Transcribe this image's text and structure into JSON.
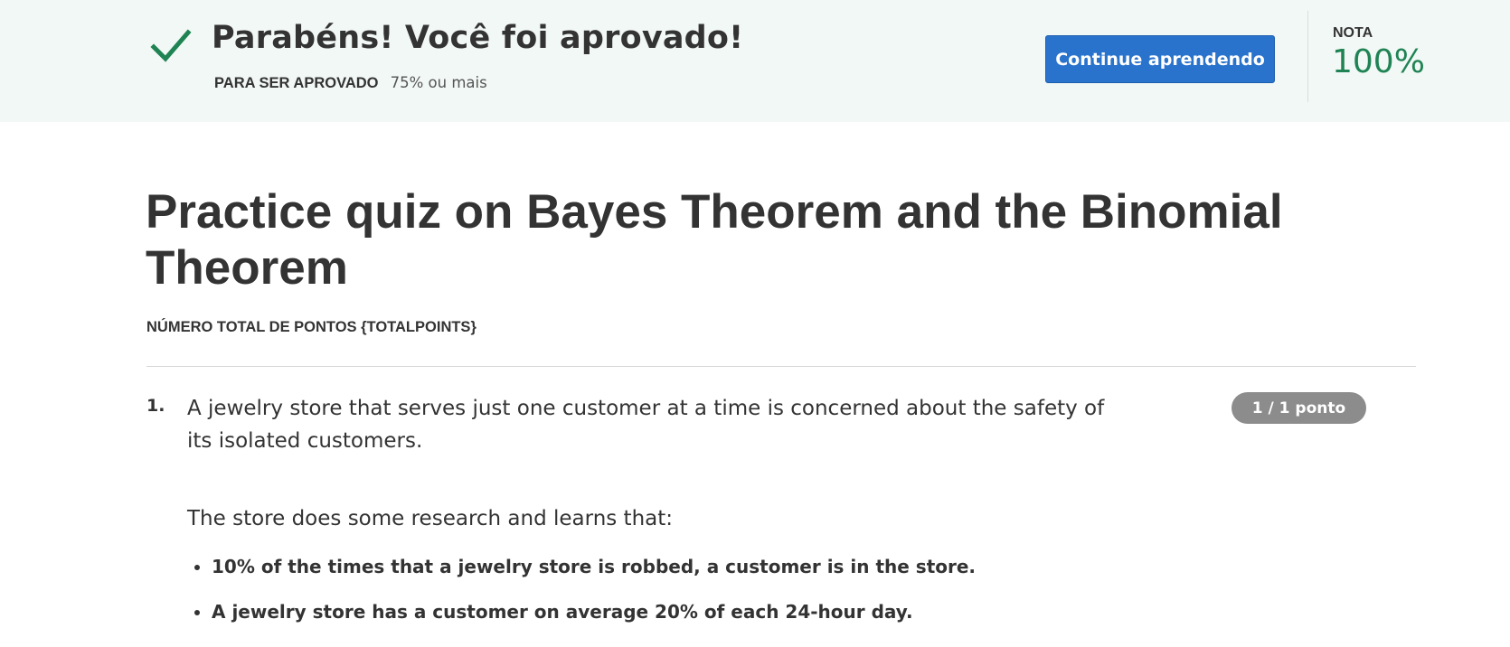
{
  "banner": {
    "title": "Parabéns! Você foi aprovado!",
    "pass_label": "PARA SER APROVADO",
    "pass_value": "75% ou mais",
    "continue_label": "Continue aprendendo",
    "grade_label": "NOTA",
    "grade_value": "100%",
    "colors": {
      "background": "#f2f8f5",
      "success": "#1f8354",
      "button": "#2a73cc"
    },
    "icon": "checkmark-icon"
  },
  "quiz": {
    "title": "Practice quiz on Bayes Theorem and the Binomial Theorem",
    "total_points_label": "NÚMERO TOTAL DE PONTOS {TOTALPOINTS}"
  },
  "question": {
    "number": "1.",
    "text": "A jewelry store that serves just one customer at a time is concerned about the safety of its isolated customers.",
    "points": "1 / 1 ponto",
    "intro": "The store does some research and learns that:",
    "facts": [
      "10% of the times that a jewelry store is robbed, a customer is in the store.",
      "A jewelry store has a customer on average 20% of each 24-hour day."
    ]
  }
}
